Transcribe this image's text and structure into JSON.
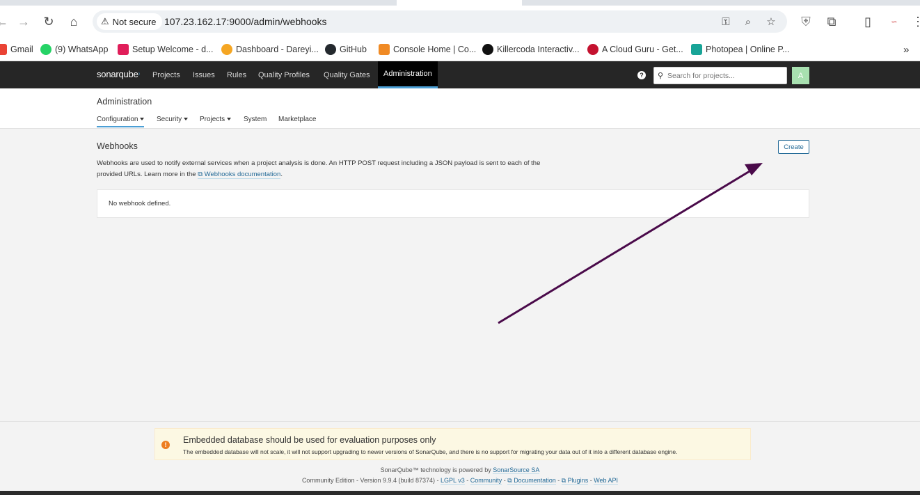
{
  "browser": {
    "security_label": "Not secure",
    "url": "107.23.162.17:9000/admin/webhooks",
    "bookmarks": [
      {
        "label": "Gmail",
        "color": "#ea4335"
      },
      {
        "label": "(9) WhatsApp",
        "color": "#25d366"
      },
      {
        "label": "Setup Welcome - d...",
        "color": "#e01e5a"
      },
      {
        "label": "Dashboard - Dareyi...",
        "color": "#f5a623"
      },
      {
        "label": "GitHub",
        "color": "#24292e"
      },
      {
        "label": "Console Home | Co...",
        "color": "#f08a24"
      },
      {
        "label": "Killercoda Interactiv...",
        "color": "#111111"
      },
      {
        "label": "A Cloud Guru - Get...",
        "color": "#c4122f"
      },
      {
        "label": "Photopea | Online P...",
        "color": "#18a497"
      }
    ]
  },
  "sonar": {
    "logo_a": "sonar",
    "logo_b": "qube",
    "nav": [
      "Projects",
      "Issues",
      "Rules",
      "Quality Profiles",
      "Quality Gates",
      "Administration"
    ],
    "help": "?",
    "search_placeholder": "Search for projects...",
    "avatar": "A"
  },
  "admin": {
    "title": "Administration",
    "tabs": [
      "Configuration",
      "Security",
      "Projects",
      "System",
      "Marketplace"
    ]
  },
  "webhooks": {
    "title": "Webhooks",
    "desc_1": "Webhooks are used to notify external services when a project analysis is done. An HTTP POST request including a JSON payload is sent to each of the provided URLs. Learn more in the ",
    "doc_link": "Webhooks documentation",
    "desc_2": ".",
    "create_label": "Create",
    "empty": "No webhook defined."
  },
  "footer": {
    "warning_title": "Embedded database should be used for evaluation purposes only",
    "warning_body": "The embedded database will not scale, it will not support upgrading to newer versions of SonarQube, and there is no support for migrating your data out of it into a different database engine.",
    "powered_prefix": "SonarQube™ technology is powered by ",
    "powered_link": "SonarSource SA",
    "edition": "Community Edition - Version 9.9.4 (build 87374) - ",
    "lgpl": "LGPL v3",
    "sep": " - ",
    "community": "Community",
    "documentation": "Documentation",
    "plugins": "Plugins",
    "webapi": "Web API"
  },
  "annotation": {
    "arrow_color": "#4a0a4a"
  }
}
